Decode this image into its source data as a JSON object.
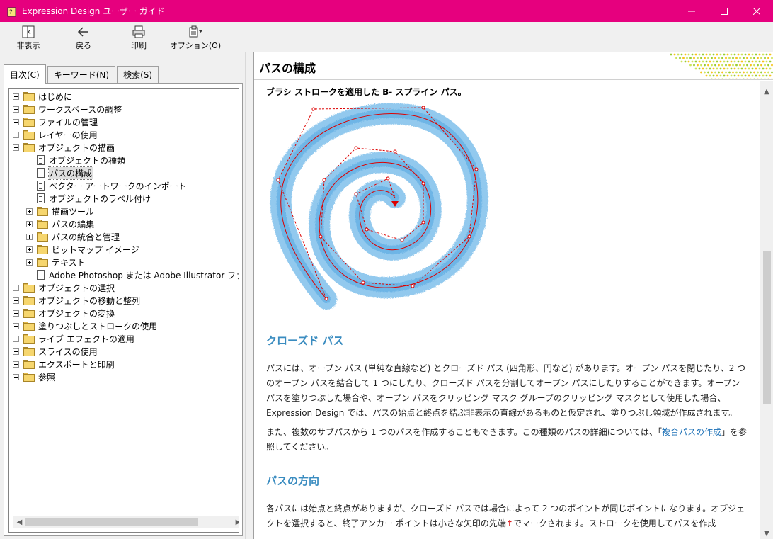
{
  "window": {
    "title": "Expression Design ユーザー ガイド",
    "minimize_icon": "minimize-icon",
    "maximize_icon": "maximize-icon",
    "close_icon": "close-icon"
  },
  "toolbar": {
    "hide_label": "非表示",
    "back_label": "戻る",
    "print_label": "印刷",
    "options_label": "オプション(O)"
  },
  "tabs": {
    "contents": "目次(C)",
    "keyword": "キーワード(N)",
    "search": "検索(S)"
  },
  "tree": [
    {
      "label": "はじめに"
    },
    {
      "label": "ワークスペースの調整"
    },
    {
      "label": "ファイルの管理"
    },
    {
      "label": "レイヤーの使用"
    },
    {
      "label": "オブジェクトの描画"
    },
    {
      "label": "オブジェクトの種類"
    },
    {
      "label": "パスの構成"
    },
    {
      "label": "ベクター アートワークのインポート"
    },
    {
      "label": "オブジェクトのラベル付け"
    },
    {
      "label": "描画ツール"
    },
    {
      "label": "パスの編集"
    },
    {
      "label": "パスの統合と管理"
    },
    {
      "label": "ビットマップ イメージ"
    },
    {
      "label": "テキスト"
    },
    {
      "label": "Adobe Photoshop または Adobe Illustrator ファイル"
    },
    {
      "label": "オブジェクトの選択"
    },
    {
      "label": "オブジェクトの移動と整列"
    },
    {
      "label": "オブジェクトの変換"
    },
    {
      "label": "塗りつぶしとストロークの使用"
    },
    {
      "label": "ライブ エフェクトの適用"
    },
    {
      "label": "スライスの使用"
    },
    {
      "label": "エクスポートと印刷"
    },
    {
      "label": "参照"
    }
  ],
  "topic": {
    "title": "パスの構成",
    "figure_caption": "ブラシ ストロークを適用した B- スプライン パス。",
    "section1_heading": "クローズド パス",
    "section1_p1": "パスには、オープン パス (単純な直線など) とクローズド パス (四角形、円など) があります。オープン パスを閉じたり、2 つのオープン パスを結合して 1 つにしたり、クローズド パスを分割してオープン パスにしたりすることができます。オープン パスを塗りつぶした場合や、オープン パスをクリッピング マスク グループのクリッピング マスクとして使用した場合、Expression Design では、パスの始点と終点を結ぶ非表示の直線があるものと仮定され、塗りつぶし領域が作成されます。",
    "section1_p2_a": "また、複数のサブパスから 1 つのパスを作成することもできます。この種類のパスの詳細については、「",
    "section1_p2_link": "複合パスの作成",
    "section1_p2_b": "」を参照してください。",
    "section2_heading": "パスの方向",
    "section2_p1_a": "各パスには始点と終点がありますが、クローズド パスでは場合によって 2 つのポイントが同じポイントになります。オブジェクトを選択すると、終了アンカー ポイントは小さな矢印の先端",
    "section2_p1_b": "でマークされます。ストロークを使用してパスを作成",
    "arrow_glyph": "↑"
  }
}
